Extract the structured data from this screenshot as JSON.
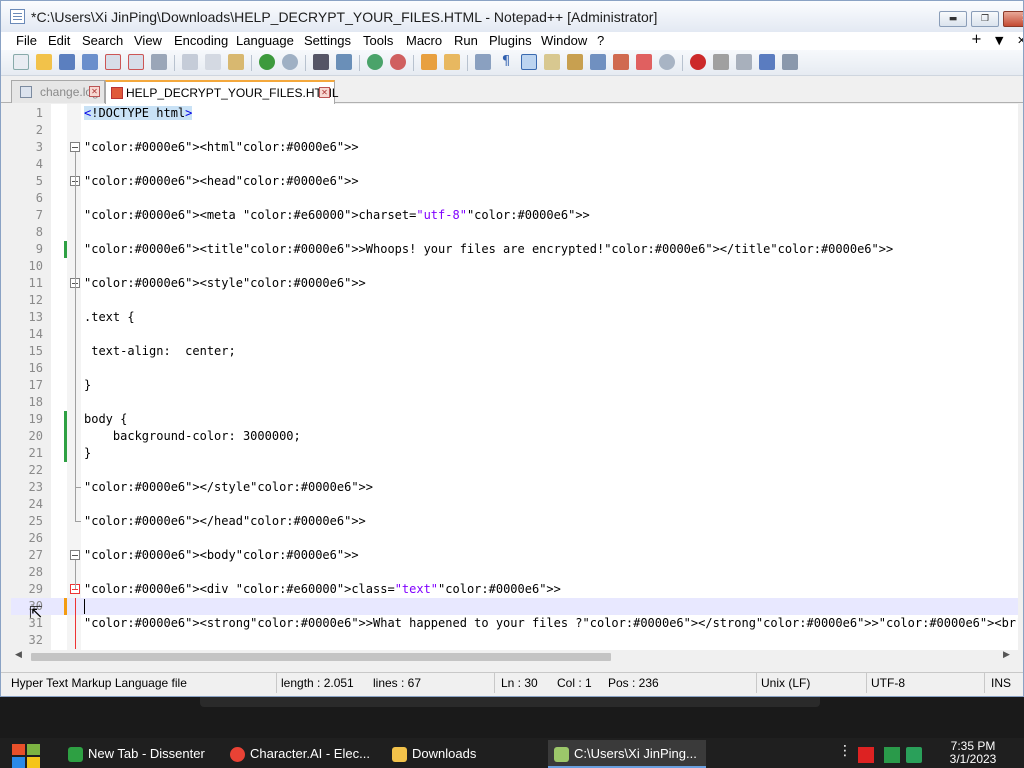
{
  "window": {
    "title": "*C:\\Users\\Xi JinPing\\Downloads\\HELP_DECRYPT_YOUR_FILES.HTML - Notepad++ [Administrator]",
    "min_label": "▬",
    "max_label": "❐",
    "close_label": "✕"
  },
  "menu": {
    "items": [
      "File",
      "Edit",
      "Search",
      "View",
      "Encoding",
      "Language",
      "Settings",
      "Tools",
      "Macro",
      "Run",
      "Plugins",
      "Window",
      "?"
    ],
    "plus": "+",
    "down": "▼",
    "close": "✕"
  },
  "tabs": [
    {
      "label": "change.log",
      "active": false
    },
    {
      "label": "HELP_DECRYPT_YOUR_FILES.HTML",
      "active": true
    }
  ],
  "editor": {
    "lines": [
      "<!DOCTYPE html>",
      "",
      "<html>",
      "",
      "<head>",
      "",
      "<meta charset=\"utf-8\">",
      "",
      "<title>Whoops! your files are encrypted!</title>",
      "",
      "<style>",
      "",
      ".text {",
      "",
      " text-align:  center;",
      "",
      "}",
      "",
      "body {",
      "    background-color: 3000000;",
      "}",
      "",
      "</style>",
      "",
      "</head>",
      "",
      "<body>",
      "",
      "<div class=\"text\">",
      "",
      "<strong>What happened to your files ?</strong><br>",
      ""
    ],
    "current_line": 30
  },
  "status": {
    "filetype": "Hyper Text Markup Language file",
    "length": "length : 2.051",
    "lines": "lines : 67",
    "ln": "Ln : 30",
    "col": "Col : 1",
    "pos": "Pos : 236",
    "eol": "Unix (LF)",
    "encoding": "UTF-8",
    "mode": "INS"
  },
  "taskbar": {
    "items": [
      {
        "label": "New Tab - Dissenter",
        "icon": "dissenter-icon",
        "color": "#2ea043"
      },
      {
        "label": "Character.AI - Elec...",
        "icon": "chrome-icon",
        "color": "#e94235"
      },
      {
        "label": "Downloads",
        "icon": "folder-icon",
        "color": "#f2c24a"
      },
      {
        "label": "C:\\Users\\Xi JinPing...",
        "icon": "notepadpp-icon",
        "color": "#9cc76a"
      }
    ],
    "time": "7:35 PM",
    "date": "3/1/2023"
  },
  "colors": {
    "tag": "#0000e6",
    "attr": "#e60000",
    "value": "#8000ff",
    "changed_saved": "#2ea043",
    "changed_unsaved": "#f39c12",
    "tab_accent": "#f4a83c"
  }
}
